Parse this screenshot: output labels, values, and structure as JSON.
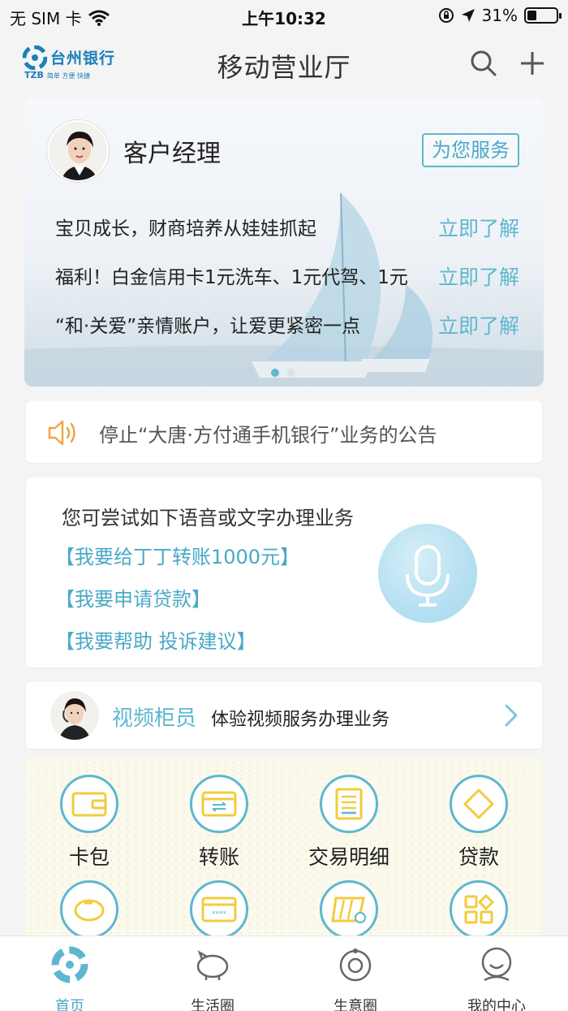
{
  "status_bar": {
    "carrier": "无 SIM 卡",
    "time": "上午10:32",
    "battery": "31%",
    "battery_level": 0.31
  },
  "header": {
    "title": "移动营业厅",
    "logo_name": "台州银行",
    "logo_abbr": "TZB",
    "logo_slogan": "简单 方便 快捷"
  },
  "banner": {
    "manager_title": "客户经理",
    "serve_button": "为您服务",
    "promos": [
      {
        "text": "宝贝成长，财商培养从娃娃抓起",
        "link": "立即了解"
      },
      {
        "text": "福利！白金信用卡1元洗车、1元代驾、1元",
        "link": "立即了解"
      },
      {
        "text": "“和·关爱”亲情账户，让爱更紧密一点",
        "link": "立即了解"
      }
    ]
  },
  "notice": {
    "text": "停止“大唐·方付通手机银行”业务的公告"
  },
  "voice": {
    "title": "您可尝试如下语音或文字办理业务",
    "options": [
      "【我要给丁丁转账1000元】",
      "【我要申请贷款】",
      "【我要帮助 投诉建议】"
    ]
  },
  "video": {
    "title": "视频柜员",
    "desc": "体验视频服务办理业务"
  },
  "services": [
    {
      "label": "卡包",
      "icon": "wallet-icon"
    },
    {
      "label": "转账",
      "icon": "transfer-icon"
    },
    {
      "label": "交易明细",
      "icon": "transaction-details-icon"
    },
    {
      "label": "贷款",
      "icon": "loan-icon"
    }
  ],
  "tabs": [
    {
      "label": "首页",
      "icon": "home-icon"
    },
    {
      "label": "生活圈",
      "icon": "life-circle-icon"
    },
    {
      "label": "生意圈",
      "icon": "business-circle-icon"
    },
    {
      "label": "我的中心",
      "icon": "my-center-icon"
    }
  ],
  "colors": {
    "accent": "#5fb6cf",
    "icon_yellow": "#f2cc3c",
    "background": "#f4f4f5"
  }
}
